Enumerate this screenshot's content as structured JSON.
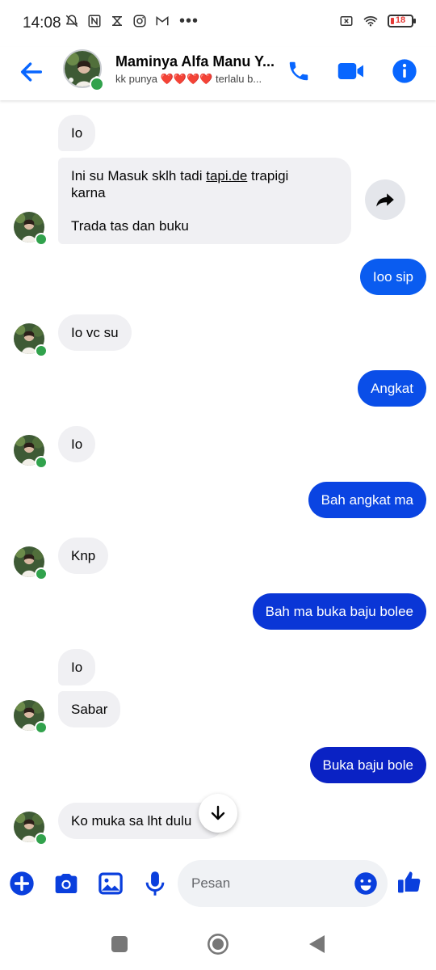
{
  "status_bar": {
    "time": "14:08",
    "left_icons": [
      "bell-off-icon",
      "nfc-icon",
      "capcut-icon",
      "instagram-icon",
      "gmail-icon"
    ],
    "more": "•••",
    "battery_level": "18",
    "battery_fraction": 0.18,
    "battery_color": "#e53935"
  },
  "header": {
    "contact_name": "Maminya Alfa Manu Y...",
    "subtitle_prefix": "kk punya",
    "subtitle_hearts": "❤️❤️❤️❤️",
    "subtitle_suffix": "terlalu b...",
    "online_color": "#31a24c",
    "accent": "#0866ff"
  },
  "messages": {
    "m1": "Io",
    "m2_line1_before": "Ini su Masuk sklh tadi ",
    "m2_link": "tapi.de",
    "m2_line1_after": " trapigi",
    "m2_line2": "karna",
    "m2_line3": "Trada tas dan buku",
    "m3": "Ioo sip",
    "m4": "Io vc su",
    "m5": "Angkat",
    "m6": "Io",
    "m7": "Bah angkat ma",
    "m8": "Knp",
    "m9": "Bah ma buka baju bolee",
    "m10": "Io",
    "m11": "Sabar",
    "m12": "Buka baju bole",
    "m13": "Ko muka sa lht dulu"
  },
  "colors": {
    "incoming_bg": "#f0f0f3",
    "outgoing_gradient": [
      "#0a5cf0",
      "#0a3fdd",
      "#0a22c4"
    ]
  },
  "composer": {
    "placeholder": "Pesan"
  }
}
